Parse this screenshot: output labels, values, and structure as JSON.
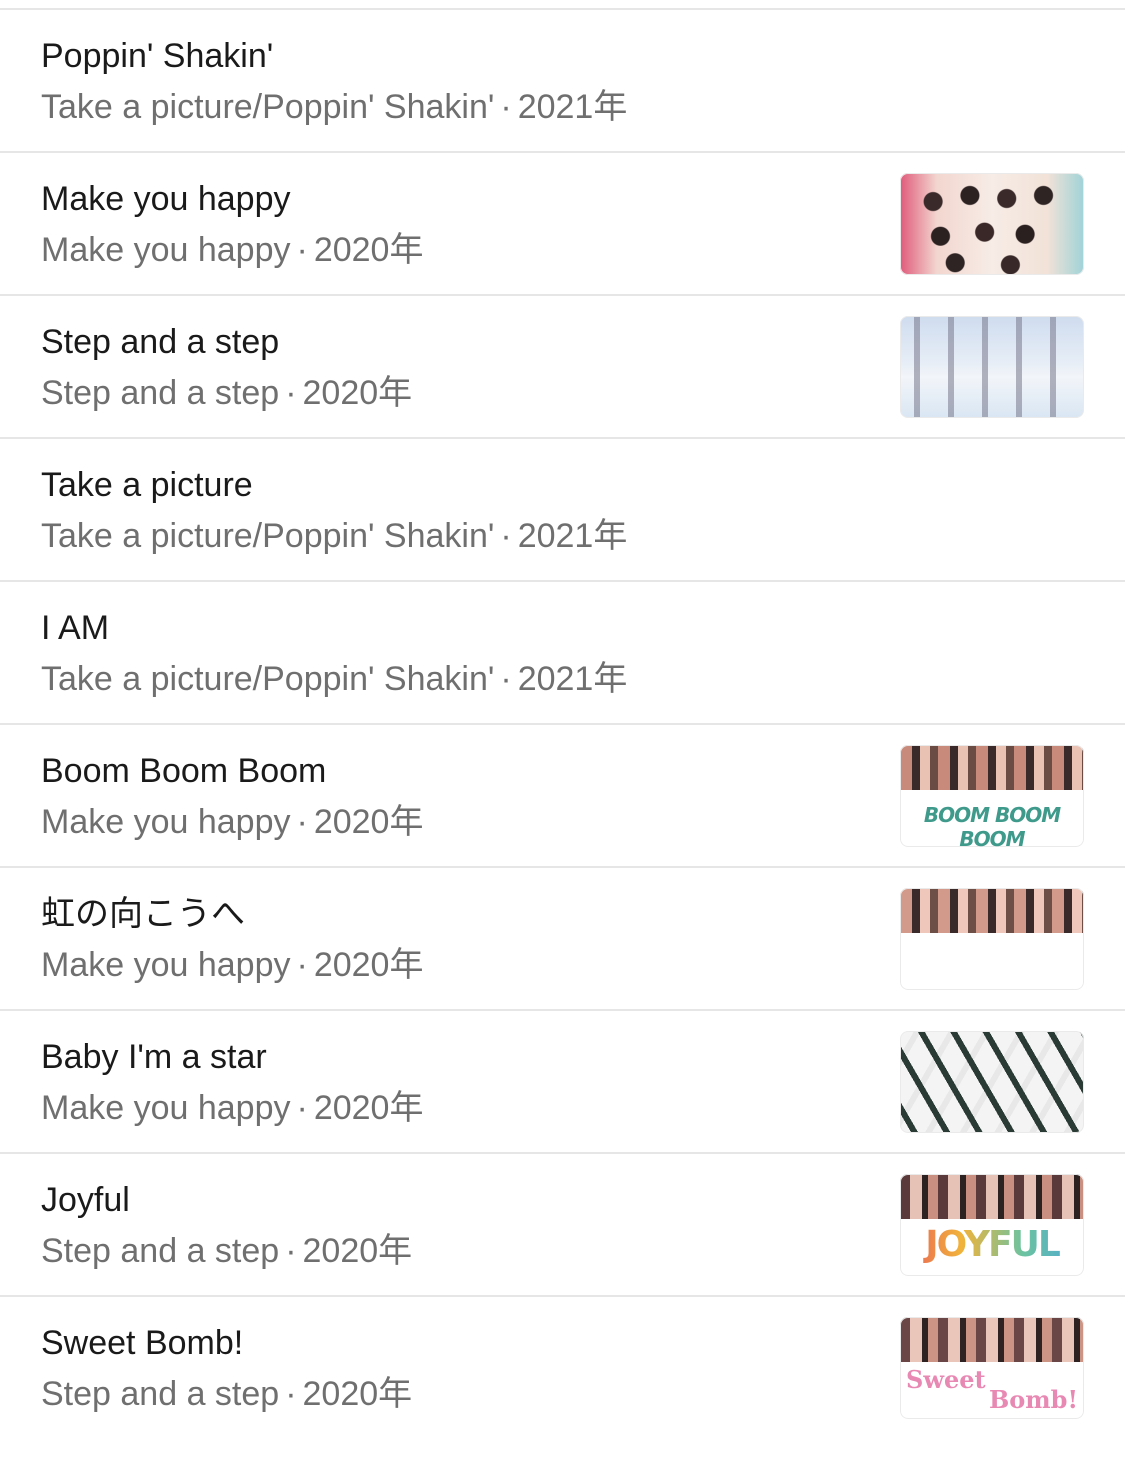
{
  "songs": [
    {
      "title": "Poppin' Shakin'",
      "album": "Take a picture/Poppin' Shakin'",
      "year": "2021年",
      "thumbnail": null
    },
    {
      "title": "Make you happy",
      "album": "Make you happy",
      "year": "2020年",
      "thumbnail": "album-art-make-you-happy"
    },
    {
      "title": "Step and a step",
      "album": "Step and a step",
      "year": "2020年",
      "thumbnail": "album-art-step-and-a-step"
    },
    {
      "title": "Take a picture",
      "album": "Take a picture/Poppin' Shakin'",
      "year": "2021年",
      "thumbnail": null
    },
    {
      "title": "I AM",
      "album": "Take a picture/Poppin' Shakin'",
      "year": "2021年",
      "thumbnail": null
    },
    {
      "title": "Boom Boom Boom",
      "album": "Make you happy",
      "year": "2020年",
      "thumbnail": "album-art-boom-boom-boom",
      "art_text": "BOOM BOOM BOOM"
    },
    {
      "title": "虹の向こうへ",
      "album": "Make you happy",
      "year": "2020年",
      "thumbnail": "album-art-rainbow"
    },
    {
      "title": "Baby I'm a star",
      "album": "Make you happy",
      "year": "2020年",
      "thumbnail": "album-art-baby-im-a-star"
    },
    {
      "title": "Joyful",
      "album": "Step and a step",
      "year": "2020年",
      "thumbnail": "album-art-joyful",
      "art_text": "JOYFUL"
    },
    {
      "title": "Sweet Bomb!",
      "album": "Step and a step",
      "year": "2020年",
      "thumbnail": "album-art-sweet-bomb",
      "art_text_1": "Sweet",
      "art_text_2": "Bomb!"
    }
  ],
  "separator": "·"
}
